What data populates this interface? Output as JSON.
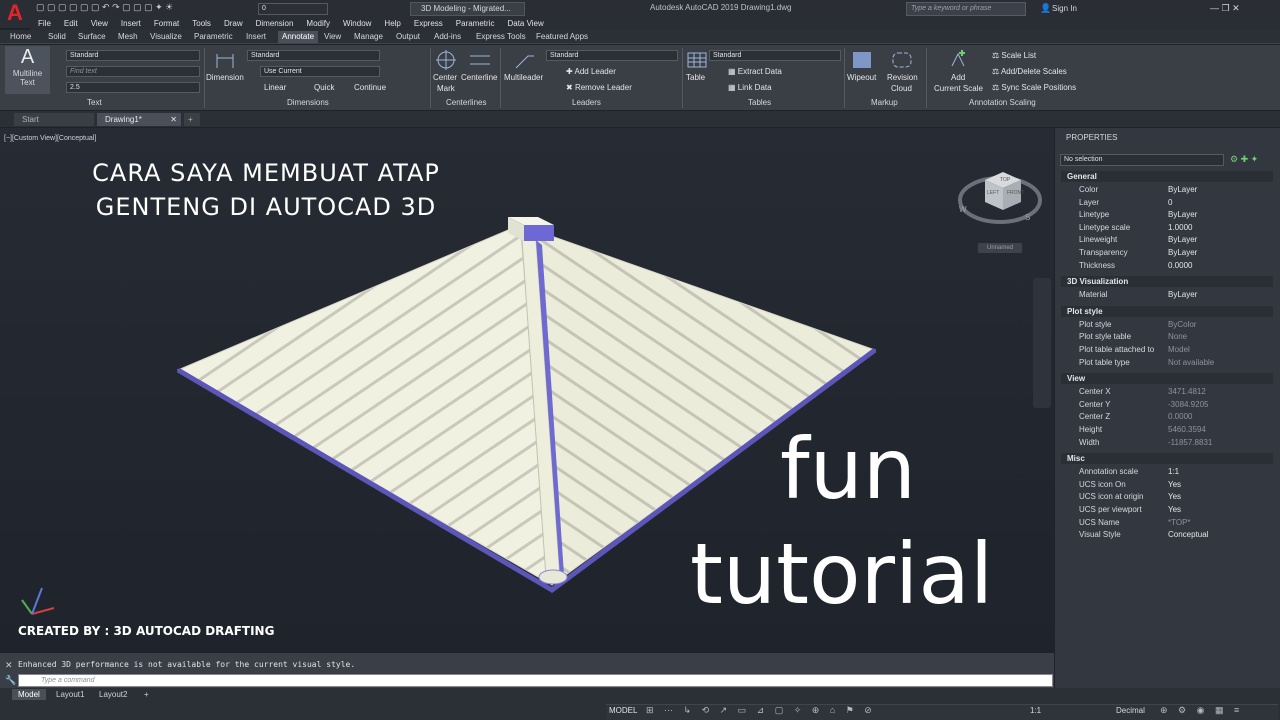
{
  "titlebar": {
    "logo": "A",
    "workspace": "3D Modeling - Migrated...",
    "layer": "0",
    "window_title": "Autodesk AutoCAD 2019    Drawing1.dwg",
    "search_placeholder": "Type a keyword or phrase",
    "signin": "Sign In"
  },
  "menubar": [
    "File",
    "Edit",
    "View",
    "Insert",
    "Format",
    "Tools",
    "Draw",
    "Dimension",
    "Modify",
    "Window",
    "Help",
    "Express",
    "Parametric",
    "Data View"
  ],
  "ribbon_tabs": [
    "Home",
    "Solid",
    "Surface",
    "Mesh",
    "Visualize",
    "Parametric",
    "Insert",
    "Annotate",
    "View",
    "Manage",
    "Output",
    "Add-ins",
    "Express Tools",
    "Featured Apps"
  ],
  "ribbon": {
    "text_panel": {
      "big": "Multiline",
      "big2": "Text",
      "style": "Standard",
      "find": "Find text",
      "height": "2.5",
      "title": "Text"
    },
    "dim_panel": {
      "big": "Dimension",
      "style": "Standard",
      "layer": "Use Current",
      "linear": "Linear",
      "quick": "Quick",
      "continue": "Continue",
      "title": "Dimensions"
    },
    "center_panel": {
      "center": "Center",
      "mark": "Mark",
      "centerline": "Centerline",
      "title": "Centerlines"
    },
    "leader_panel": {
      "big": "Multileader",
      "style": "Standard",
      "add": "Add Leader",
      "remove": "Remove Leader",
      "title": "Leaders"
    },
    "table_panel": {
      "big": "Table",
      "style": "Standard",
      "extract": "Extract Data",
      "link": "Link Data",
      "title": "Tables"
    },
    "markup_panel": {
      "wipeout": "Wipeout",
      "revision": "Revision",
      "cloud": "Cloud",
      "title": "Markup"
    },
    "scale_panel": {
      "add": "Add",
      "current": "Current Scale",
      "list": "Scale List",
      "adddel": "Add/Delete Scales",
      "sync": "Sync Scale Positions",
      "title": "Annotation Scaling"
    }
  },
  "doc_tabs": [
    "Start",
    "Drawing1*"
  ],
  "viewport": {
    "label": "[−][Custom View][Conceptual]",
    "title1": "CARA SAYA MEMBUAT ATAP",
    "title2": "GENTENG DI AUTOCAD 3D",
    "fun": "fun",
    "tutorial": "tutorial",
    "credit": "CREATED BY : 3D AUTOCAD DRAFTING",
    "viewcube": {
      "left": "LEFT",
      "front": "FRONT",
      "top": "TOP",
      "w": "W",
      "s": "S",
      "unnamed": "Unnamed"
    }
  },
  "properties": {
    "title": "PROPERTIES",
    "selection": "No selection",
    "sections": [
      {
        "name": "General",
        "rows": [
          [
            "Color",
            "ByLayer"
          ],
          [
            "Layer",
            "0"
          ],
          [
            "Linetype",
            "ByLayer"
          ],
          [
            "Linetype scale",
            "1.0000"
          ],
          [
            "Lineweight",
            "ByLayer"
          ],
          [
            "Transparency",
            "ByLayer"
          ],
          [
            "Thickness",
            "0.0000"
          ]
        ]
      },
      {
        "name": "3D Visualization",
        "rows": [
          [
            "Material",
            "ByLayer"
          ]
        ]
      },
      {
        "name": "Plot style",
        "rows": [
          [
            "Plot style",
            "ByColor"
          ],
          [
            "Plot style table",
            "None"
          ],
          [
            "Plot table attached to",
            "Model"
          ],
          [
            "Plot table type",
            "Not available"
          ]
        ]
      },
      {
        "name": "View",
        "rows": [
          [
            "Center X",
            "3471.4812"
          ],
          [
            "Center Y",
            "-3084.9205"
          ],
          [
            "Center Z",
            "0.0000"
          ],
          [
            "Height",
            "5460.3594"
          ],
          [
            "Width",
            "-11857.8831"
          ]
        ]
      },
      {
        "name": "Misc",
        "rows": [
          [
            "Annotation scale",
            "1:1"
          ],
          [
            "UCS icon On",
            "Yes"
          ],
          [
            "UCS icon at origin",
            "Yes"
          ],
          [
            "UCS per viewport",
            "Yes"
          ],
          [
            "UCS Name",
            "*TOP*"
          ],
          [
            "Visual Style",
            "Conceptual"
          ]
        ]
      }
    ]
  },
  "command": {
    "history": "Enhanced 3D performance is not available for the current visual style.",
    "placeholder": "Type a command"
  },
  "status": {
    "tabs": [
      "Model",
      "Layout1",
      "Layout2"
    ],
    "model": "MODEL",
    "scale": "1:1",
    "units": "Decimal"
  }
}
